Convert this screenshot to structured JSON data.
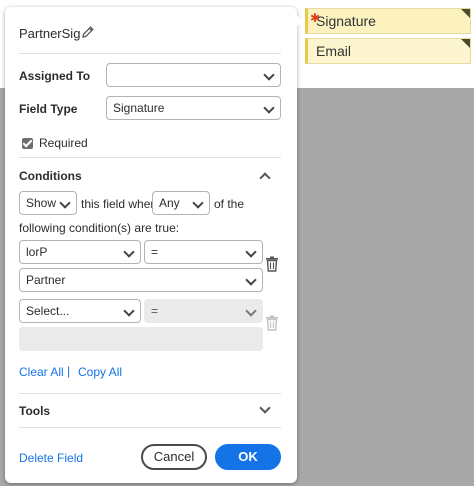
{
  "document": {
    "fields": [
      {
        "label": "Signature",
        "required": true
      },
      {
        "label": "Email",
        "required": false
      }
    ]
  },
  "panel": {
    "field_name": "PartnerSig",
    "assigned_to": {
      "label": "Assigned To",
      "value": ""
    },
    "field_type": {
      "label": "Field Type",
      "value": "Signature"
    },
    "required": {
      "label": "Required",
      "checked": true
    },
    "conditions": {
      "heading": "Conditions",
      "expanded": true,
      "action": "Show",
      "text_mid": "this field when",
      "match": "Any",
      "text_end": "of the",
      "text_line2": "following condition(s) are true:",
      "rules": [
        {
          "field": "lorP",
          "operator": "=",
          "value": "Partner",
          "disabled": false
        },
        {
          "field": "Select...",
          "operator": "=",
          "value": "",
          "disabled": true
        }
      ],
      "clear_all": "Clear All",
      "copy_all": "Copy All",
      "separator": "|"
    },
    "tools": {
      "heading": "Tools",
      "expanded": false
    },
    "footer": {
      "delete": "Delete Field",
      "cancel": "Cancel",
      "ok": "OK"
    }
  },
  "colors": {
    "accent": "#1473e6",
    "field_bg": "#fcf5cf",
    "required_star": "#e0401c"
  }
}
